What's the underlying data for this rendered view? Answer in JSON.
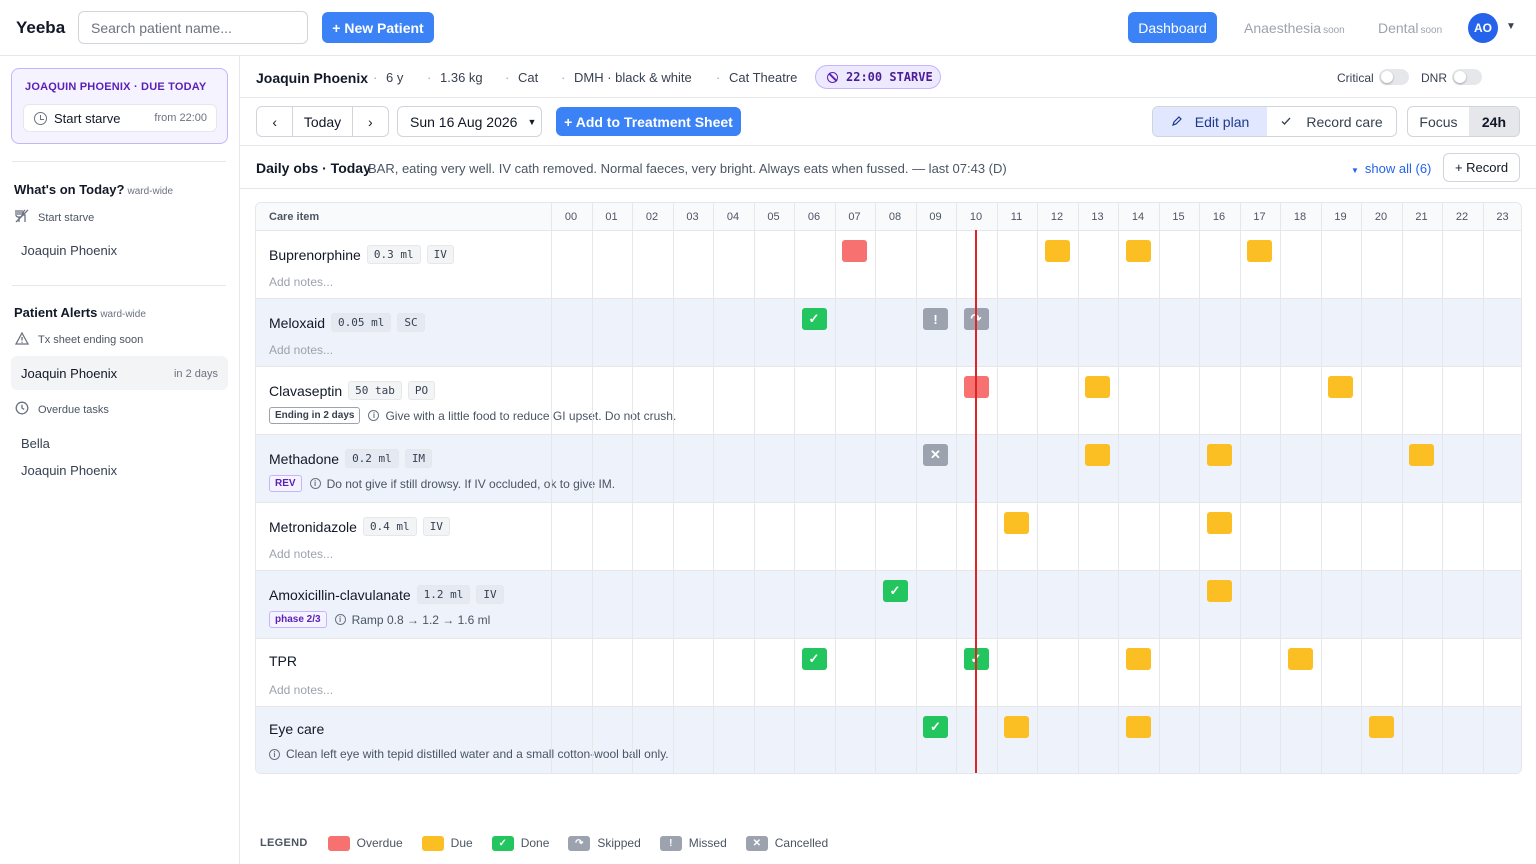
{
  "app": {
    "brand": "Yeeba"
  },
  "topbar": {
    "search_placeholder": "Search patient name...",
    "new_patient": "+ New Patient",
    "nav": {
      "dashboard": "Dashboard",
      "anaesthesia": "Anaesthesia",
      "dental": "Dental",
      "soon": "soon"
    },
    "avatar": "AO"
  },
  "sidebar": {
    "due_card": {
      "title": "JOAQUIN PHOENIX · DUE TODAY",
      "task": "Start starve",
      "from": "from 22:00"
    },
    "whats_on": {
      "title": "What's on Today?",
      "scope": "ward-wide",
      "sub": "Start starve",
      "patients": [
        "Joaquin Phoenix"
      ]
    },
    "alerts": {
      "title": "Patient Alerts",
      "scope": "ward-wide",
      "tx_ending": "Tx sheet ending soon",
      "tx_patient": "Joaquin Phoenix",
      "tx_when": "in 2 days",
      "overdue": "Overdue tasks",
      "overdue_patients": [
        "Bella",
        "Joaquin Phoenix"
      ]
    }
  },
  "patient": {
    "name": "Joaquin Phoenix",
    "age": "6 y",
    "weight": "1.36 kg",
    "species": "Cat",
    "breed": "DMH · black & white",
    "location": "Cat Theatre",
    "starve": "22:00 STARVE",
    "critical": "Critical",
    "dnr": "DNR"
  },
  "toolbar": {
    "prev": "‹",
    "today": "Today",
    "next": "›",
    "date": "Sun 16 Aug 2026",
    "add": "+ Add to Treatment Sheet",
    "edit_plan": "Edit plan",
    "record_care": "Record care",
    "focus": "Focus",
    "h24": "24h"
  },
  "obs": {
    "title": "Daily obs · Today",
    "text": "BAR, eating very well. IV cath removed. Normal faeces, very bright. Always eats when fussed. — last 07:43 (D)",
    "show_all": "show all (6)",
    "record": "+ Record"
  },
  "grid": {
    "care_header": "Care item",
    "hours": [
      "00",
      "01",
      "02",
      "03",
      "04",
      "05",
      "06",
      "07",
      "08",
      "09",
      "10",
      "11",
      "12",
      "13",
      "14",
      "15",
      "16",
      "17",
      "18",
      "19",
      "20",
      "21",
      "22",
      "23"
    ],
    "now_hour": 10.5,
    "rows": [
      {
        "name": "Buprenorphine",
        "dose": "0.3 ml",
        "route": "IV",
        "note": "Add notes...",
        "note_type": "placeholder",
        "cells": [
          [
            7,
            "overdue"
          ],
          [
            12,
            "due"
          ],
          [
            14,
            "due"
          ],
          [
            17,
            "due"
          ]
        ]
      },
      {
        "name": "Meloxaid",
        "dose": "0.05 ml",
        "route": "SC",
        "note": "Add notes...",
        "note_type": "placeholder",
        "cells": [
          [
            6,
            "done"
          ],
          [
            9,
            "missed"
          ],
          [
            10,
            "skipped"
          ]
        ]
      },
      {
        "name": "Clavaseptin",
        "dose": "50 tab",
        "route": "PO",
        "tag": "Ending in 2 days",
        "tag_style": "gray",
        "note": "Give with a little food to reduce GI upset. Do not crush.",
        "note_type": "info",
        "cells": [
          [
            10,
            "overdue"
          ],
          [
            13,
            "due"
          ],
          [
            19,
            "due"
          ]
        ]
      },
      {
        "name": "Methadone",
        "dose": "0.2 ml",
        "route": "IM",
        "tag": "REV",
        "tag_style": "purple",
        "note": "Do not give if still drowsy. If IV occluded, ok to give IM.",
        "note_type": "info",
        "cells": [
          [
            9,
            "cancelled"
          ],
          [
            13,
            "due"
          ],
          [
            16,
            "due"
          ],
          [
            21,
            "due"
          ]
        ]
      },
      {
        "name": "Metronidazole",
        "dose": "0.4 ml",
        "route": "IV",
        "note": "Add notes...",
        "note_type": "placeholder",
        "cells": [
          [
            11,
            "due"
          ],
          [
            16,
            "due"
          ]
        ]
      },
      {
        "name": "Amoxicillin-clavulanate",
        "dose": "1.2 ml",
        "route": "IV",
        "tag": "phase 2/3",
        "tag_style": "purple",
        "note": "Ramp 0.8 → 1.2 → 1.6 ml",
        "note_type": "info",
        "cells": [
          [
            8,
            "done"
          ],
          [
            16,
            "due"
          ]
        ]
      },
      {
        "name": "TPR",
        "note": "Add notes...",
        "note_type": "placeholder",
        "cells": [
          [
            6,
            "done"
          ],
          [
            10,
            "done"
          ],
          [
            14,
            "due"
          ],
          [
            18,
            "due"
          ]
        ]
      },
      {
        "name": "Eye care",
        "note": "Clean left eye with tepid distilled water and a small cotton-wool ball only.",
        "note_type": "info",
        "cells": [
          [
            9,
            "done"
          ],
          [
            11,
            "due"
          ],
          [
            14,
            "due"
          ],
          [
            20,
            "due"
          ]
        ]
      }
    ]
  },
  "legend": {
    "title": "LEGEND",
    "items": [
      {
        "key": "overdue",
        "label": "Overdue"
      },
      {
        "key": "due",
        "label": "Due"
      },
      {
        "key": "done",
        "label": "Done"
      },
      {
        "key": "skipped",
        "label": "Skipped"
      },
      {
        "key": "missed",
        "label": "Missed"
      },
      {
        "key": "cancelled",
        "label": "Cancelled"
      }
    ]
  },
  "colors": {
    "overdue": "#f87171",
    "due": "#fbbf24",
    "done": "#22c55e",
    "skipped": "#9ca3af",
    "missed": "#9ca3af",
    "cancelled": "#9ca3af",
    "accent": "#3b82f6",
    "now_line": "#dc2626"
  },
  "icons": {
    "done": "check-icon",
    "skipped": "skip-icon",
    "missed": "exclamation-icon",
    "cancelled": "x-icon"
  }
}
